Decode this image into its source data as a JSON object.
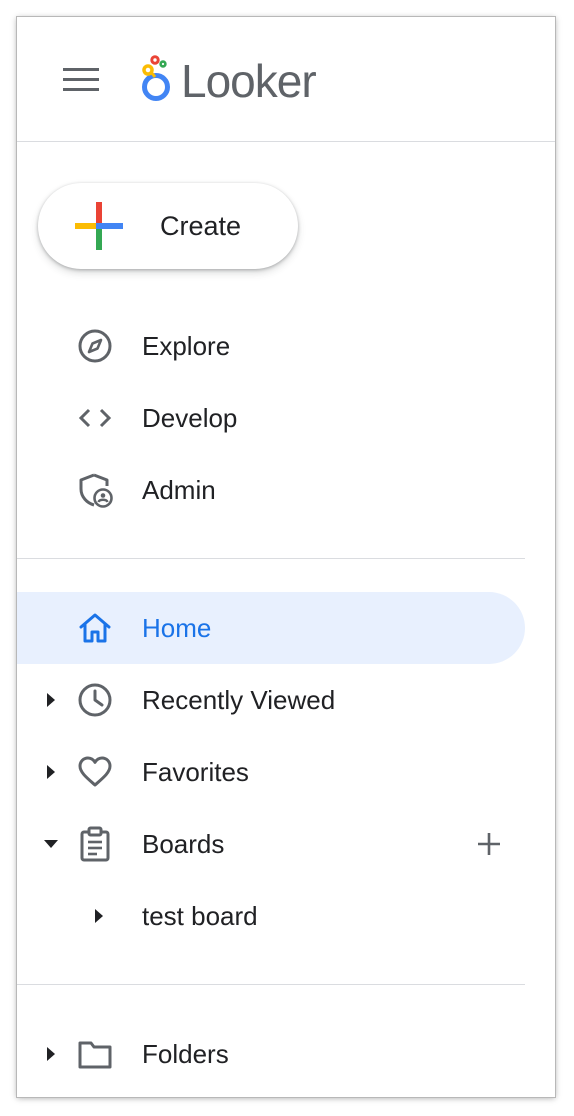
{
  "header": {
    "menu_icon": "hamburger-menu-icon",
    "logo_text": "Looker",
    "logo_colors": [
      "#EA4335",
      "#FBBC04",
      "#34A853",
      "#4285F4"
    ]
  },
  "create": {
    "label": "Create",
    "icon": "google-plus-icon"
  },
  "nav": {
    "primary": [
      {
        "label": "Explore",
        "icon": "compass-icon"
      },
      {
        "label": "Develop",
        "icon": "code-icon"
      },
      {
        "label": "Admin",
        "icon": "shield-person-icon"
      }
    ],
    "content": [
      {
        "label": "Home",
        "icon": "home-icon",
        "active": true
      },
      {
        "label": "Recently Viewed",
        "icon": "clock-icon",
        "expandable": true,
        "expanded": false
      },
      {
        "label": "Favorites",
        "icon": "heart-icon",
        "expandable": true,
        "expanded": false
      },
      {
        "label": "Boards",
        "icon": "clipboard-icon",
        "expandable": true,
        "expanded": true
      }
    ],
    "boards_children": [
      {
        "label": "test board",
        "expandable": true,
        "expanded": false
      }
    ],
    "folders": {
      "label": "Folders",
      "icon": "folder-icon",
      "expandable": true,
      "expanded": false
    }
  },
  "colors": {
    "active_bg": "#e8f0fe",
    "active_text": "#1a73e8",
    "icon_gray": "#5f6368",
    "text": "#202124"
  }
}
